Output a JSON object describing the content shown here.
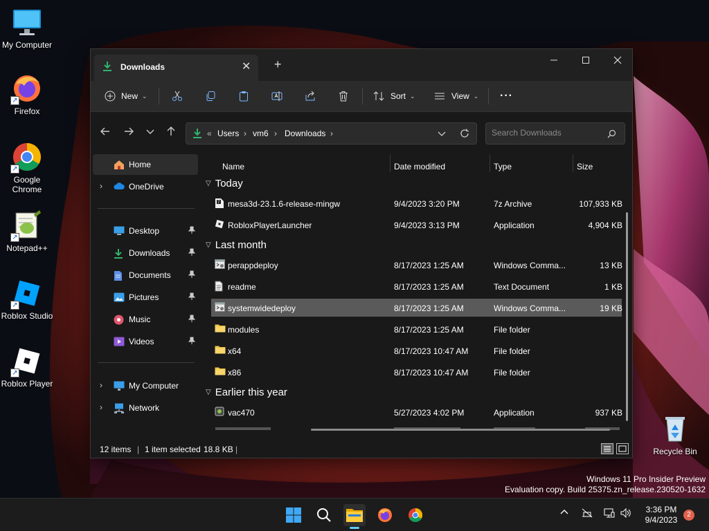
{
  "desktop": {
    "icons": [
      {
        "label": "My Computer"
      },
      {
        "label": "Firefox"
      },
      {
        "label": "Google Chrome"
      },
      {
        "label": "Notepad++"
      },
      {
        "label": "Roblox Studio"
      },
      {
        "label": "Roblox Player"
      },
      {
        "label": "Recycle Bin"
      }
    ],
    "watermark": {
      "line1": "Windows 11 Pro Insider Preview",
      "line2": "Evaluation copy. Build 25375.zn_release.230520-1632"
    }
  },
  "explorer": {
    "tab_title": "Downloads",
    "toolbar": {
      "new_label": "New",
      "sort_label": "Sort",
      "view_label": "View",
      "more_label": "···"
    },
    "address": {
      "overflow": "«",
      "crumbs": [
        "Users",
        "vm6",
        "Downloads"
      ],
      "crumb_sep": "›"
    },
    "search": {
      "placeholder": "Search Downloads"
    },
    "nav_pane": {
      "home": "Home",
      "onedrive": "OneDrive",
      "quick_access": [
        {
          "label": "Desktop"
        },
        {
          "label": "Downloads"
        },
        {
          "label": "Documents"
        },
        {
          "label": "Pictures"
        },
        {
          "label": "Music"
        },
        {
          "label": "Videos"
        }
      ],
      "my_computer": "My Computer",
      "network": "Network"
    },
    "columns": {
      "name": "Name",
      "date": "Date modified",
      "type": "Type",
      "size": "Size"
    },
    "groups": [
      {
        "label": "Today",
        "files": [
          {
            "name": "mesa3d-23.1.6-release-mingw",
            "date": "9/4/2023 3:20 PM",
            "type": "7z Archive",
            "size": "107,933 KB",
            "icon": "archive-icon"
          },
          {
            "name": "RobloxPlayerLauncher",
            "date": "9/4/2023 3:13 PM",
            "type": "Application",
            "size": "4,904 KB",
            "icon": "roblox-app-icon"
          }
        ]
      },
      {
        "label": "Last month",
        "files": [
          {
            "name": "perappdeploy",
            "date": "8/17/2023 1:25 AM",
            "type": "Windows Comma...",
            "size": "13 KB",
            "icon": "script-icon"
          },
          {
            "name": "readme",
            "date": "8/17/2023 1:25 AM",
            "type": "Text Document",
            "size": "1 KB",
            "icon": "text-document-icon"
          },
          {
            "name": "systemwidedeploy",
            "date": "8/17/2023 1:25 AM",
            "type": "Windows Comma...",
            "size": "19 KB",
            "icon": "script-icon",
            "selected": true
          },
          {
            "name": "modules",
            "date": "8/17/2023 1:25 AM",
            "type": "File folder",
            "size": "",
            "icon": "folder-icon"
          },
          {
            "name": "x64",
            "date": "8/17/2023 10:47 AM",
            "type": "File folder",
            "size": "",
            "icon": "folder-icon"
          },
          {
            "name": "x86",
            "date": "8/17/2023 10:47 AM",
            "type": "File folder",
            "size": "",
            "icon": "folder-icon"
          }
        ]
      },
      {
        "label": "Earlier this year",
        "files": [
          {
            "name": "vac470",
            "date": "5/27/2023 4:02 PM",
            "type": "Application",
            "size": "937 KB",
            "icon": "app-icon"
          }
        ]
      }
    ],
    "status": {
      "items": "12 items",
      "selected": "1 item selected",
      "size": "18.8 KB",
      "divider": "|"
    }
  },
  "taskbar": {
    "time": "3:36 PM",
    "date": "9/4/2023",
    "notification_count": "2"
  },
  "colors": {
    "accent_folder": "#f2c84b",
    "download_arrow": "#2fb36e",
    "selected_row": "#5a5a5a",
    "window_bg": "#191919",
    "toolbar_bg": "#2b2b2b"
  }
}
